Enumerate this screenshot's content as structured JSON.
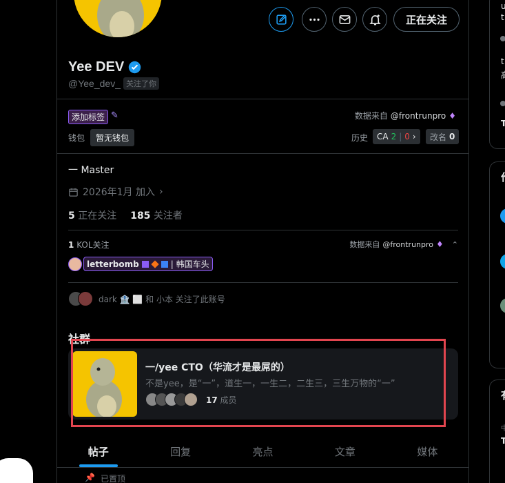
{
  "profile": {
    "name": "Yee DEV",
    "handle": "@Yee_dev_",
    "follows_you": "关注了你",
    "bio": "一 Master",
    "joined": "2026年1月 加入",
    "following_count": "5",
    "following_label": "正在关注",
    "followers_count": "185",
    "followers_label": "关注者"
  },
  "actions": {
    "following_button": "正在关注"
  },
  "extension": {
    "add_tag": "添加标签",
    "source_label": "数据来自",
    "source_name": "@frontrunpro",
    "wallet_label": "钱包",
    "wallet_value": "暂无钱包",
    "history_label": "历史",
    "ca_label": "CA",
    "ca_green": "2",
    "ca_red": "0",
    "rename_label": "改名",
    "rename_count": "0"
  },
  "kol": {
    "count": "1",
    "label": "KOL关注",
    "source_label": "数据来自",
    "source_name": "@frontrunpro",
    "name": "letterbomb",
    "tag": "| 韩国车头"
  },
  "followed_by": {
    "text": "dark 🏦 ⬜ 和 小本 关注了此账号"
  },
  "community": {
    "section_title": "社群",
    "name": "一/yee CTO（华流才是最屌的）",
    "description": "不是yee，是“一”，道生一，一生二，二生三，三生万物的“一”",
    "member_count": "17",
    "member_label": "成员"
  },
  "tabs": [
    "帖子",
    "回复",
    "亮点",
    "文章",
    "媒体"
  ],
  "pinned": "已置顶",
  "colors": {
    "accent": "#1d9bf0",
    "highlight": "#e2454f",
    "purple": "#8b5cf6",
    "avatar_bg": "#f5c400"
  },
  "right_rail": {
    "snippets": [
      "u",
      "t",
      "t",
      "高",
      "T",
      "作",
      "有",
      "中",
      "T"
    ]
  }
}
